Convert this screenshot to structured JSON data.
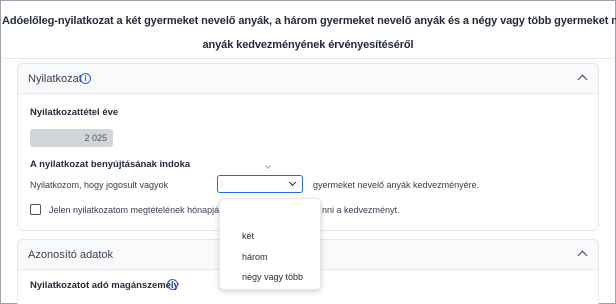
{
  "header": {
    "title_line1": "Adóelőleg-nyilatkozat a két gyermeket nevelő anyák, a három gyermeket nevelő anyák és a négy vagy több gyermeket nevelő",
    "title_line2": "anyák kedvezményének érvényesítéséről"
  },
  "nyilatkozat": {
    "section_title": "Nyilatkozat",
    "year_label": "Nyilatkozattétel éve",
    "year_value": "2 025",
    "reason_label": "A nyilatkozat benyújtásának indoka",
    "reason_prefix": "Nyilatkozom, hogy jogosult vagyok",
    "reason_suffix": "gyermeket nevelő anyák kedvezményére.",
    "checkbox_text_left": "Jelen nyilatkozatom megtételének hónapjáto",
    "checkbox_text_right": "nni a kedvezményt.",
    "dropdown_options": [
      "két",
      "három",
      "négy vagy több"
    ]
  },
  "azonosito": {
    "section_title": "Azonosító adatok",
    "person_label": "Nyilatkozatot adó magánszemély"
  },
  "colors": {
    "accent": "#2563eb",
    "input_disabled": "#d1d5db",
    "border": "#e5e7eb"
  }
}
